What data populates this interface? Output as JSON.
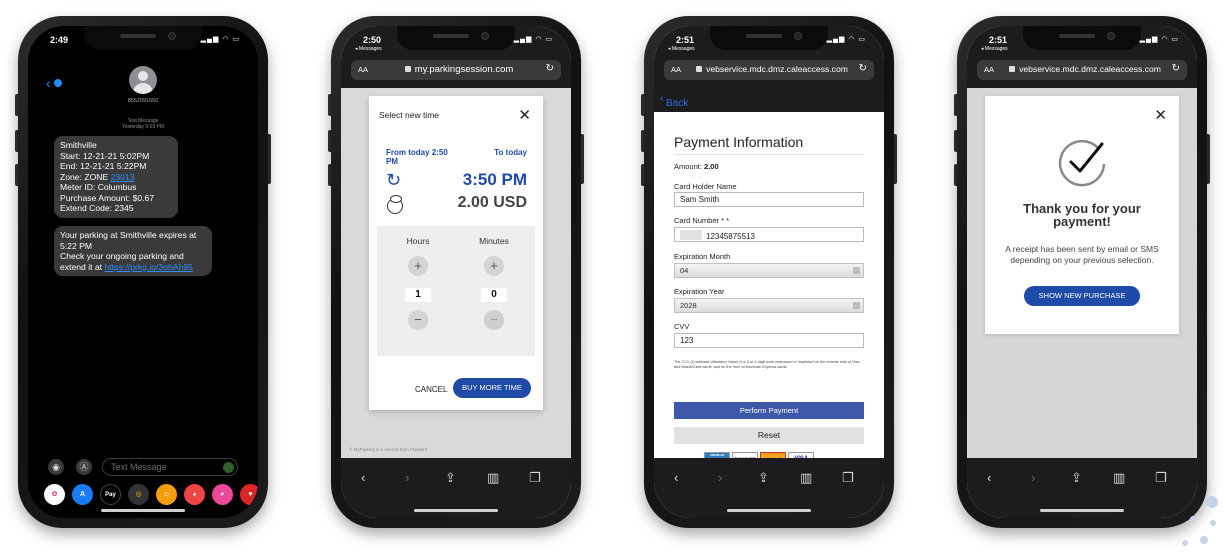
{
  "phone1": {
    "time": "2:49",
    "contact": "8552091650",
    "thread_label": "Text Message",
    "thread_time": "Yesterday 5:03 PM",
    "message1_lines": [
      "Smithville",
      "Start: 12-21-21 5:02PM",
      "End: 12-21-21 5:22PM"
    ],
    "message1_zone_prefix": "Zone: ZONE ",
    "message1_zone_link": "23013",
    "message1_lines_after": [
      "Meter ID: Columbus",
      "Purchase Amount: $0.67",
      "Extend Code: 2345"
    ],
    "message2_text": "Your parking at Smithville expires at 5:22 PM\nCheck your ongoing parking and extend it at ",
    "message2_link": "https://prkg.io/3ohAh95",
    "input_placeholder": "Text Message",
    "apple_pay_label": "Pay"
  },
  "phone2": {
    "time": "2:50",
    "back_label": "◂ Messages",
    "url": "my.parkingsession.com",
    "text_size": "AA",
    "modal_title": "Select new time",
    "from_label": "From today 2:50 PM",
    "to_label": "To today",
    "new_time": "3:50 PM",
    "price": "2.00 USD",
    "hours_label": "Hours",
    "minutes_label": "Minutes",
    "hours_value": "1",
    "minutes_value": "0",
    "cancel_label": "CANCEL",
    "buy_label": "BUY MORE TIME",
    "footer": "© MyParking is a service from Flowbird"
  },
  "phone3": {
    "time": "2:51",
    "back_label": "◂ Messages",
    "url": "vebservice.mdc.dmz.caleaccess.com",
    "text_size": "AA",
    "nav_back": "Back",
    "title": "Payment Information",
    "amount_label": "Amount:",
    "amount_value": "2.00",
    "card_holder_label": "Card Holder Name",
    "card_holder_value": "Sam Smith",
    "card_number_label": "Card Number * *",
    "card_number_value": "12345875513",
    "exp_month_label": "Expiration Month",
    "exp_month_value": "04",
    "exp_year_label": "Expiration Year",
    "exp_year_value": "2028",
    "cvv_label": "CVV",
    "cvv_value": "123",
    "cvv_note": "The CVV (Creditcard Validation Value) is a 3-or 4-digit code embossed or imprinted on the reverse side of Visa and MasterCard cards, and on the front of American Express cards.",
    "pay_label": "Perform Payment",
    "reset_label": "Reset",
    "card_logos": [
      "AMERICAN EXPRESS",
      "DISCOVER",
      "MasterCard",
      "VISA"
    ]
  },
  "phone4": {
    "time": "2:51",
    "back_label": "◂ Messages",
    "url": "vebservice.mdc.dmz.caleaccess.com",
    "text_size": "AA",
    "title": "Thank you for your payment!",
    "body": "A receipt has been sent by email or SMS depending on your previous selection.",
    "button_label": "SHOW NEW PURCHASE"
  },
  "colors": {
    "primary_blue": "#1e4aa8",
    "pay_button": "#3f57a8",
    "imessage_link": "#2f8cff",
    "bubble_grey": "#3a3a3c"
  }
}
